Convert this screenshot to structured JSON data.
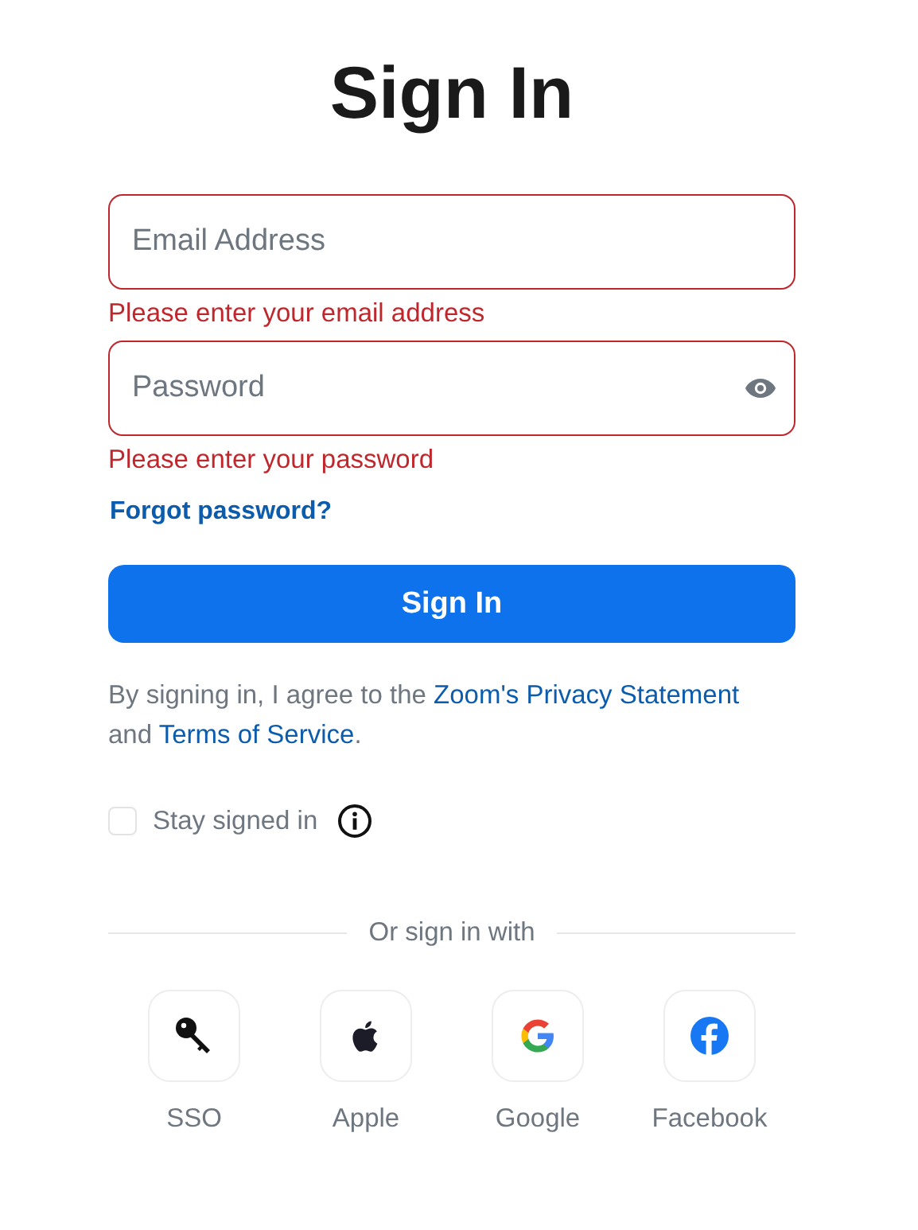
{
  "title": "Sign In",
  "fields": [
    {
      "kind": "email",
      "placeholder": "Email Address",
      "invalid": true,
      "error": "Please enter your email address"
    },
    {
      "kind": "password",
      "placeholder": "Password",
      "invalid": true,
      "error": "Please enter your password"
    }
  ],
  "forgot_link": "Forgot password?",
  "submit_button": "Sign In",
  "agreement": [
    {
      "kind": "text",
      "text": "By signing in, I agree to the "
    },
    {
      "kind": "link",
      "text": "Zoom's Privacy Statement"
    },
    {
      "kind": "text",
      "text": " and "
    },
    {
      "kind": "link",
      "text": "Terms of Service"
    },
    {
      "kind": "text",
      "text": "."
    }
  ],
  "stay_signed_in": {
    "label": "Stay signed in",
    "checked": false
  },
  "divider_label": "Or sign in with",
  "providers": [
    {
      "kind": "key",
      "label": "SSO"
    },
    {
      "kind": "apple",
      "label": "Apple"
    },
    {
      "kind": "google",
      "label": "Google"
    },
    {
      "kind": "facebook",
      "label": "Facebook"
    }
  ]
}
